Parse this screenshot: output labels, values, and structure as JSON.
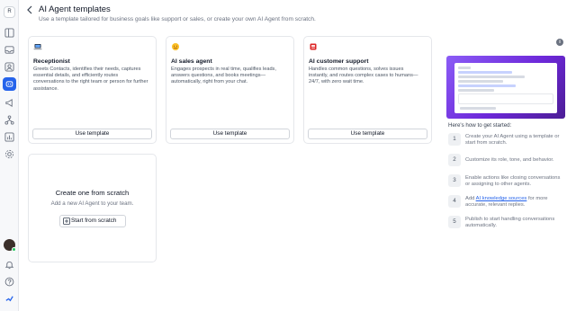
{
  "workspace": {
    "initial": "R"
  },
  "header": {
    "title": "AI Agent templates",
    "subtitle": "Use a template tailored for business goals like support or sales, or create your own AI Agent from scratch."
  },
  "templates": [
    {
      "name": "Receptionist",
      "icon": "laptop-icon",
      "description": "Greets Contacts, identifies their needs, captures essential details, and efficiently routes conversations to the right team or person for further assistance.",
      "button": "Use template"
    },
    {
      "name": "AI sales agent",
      "icon": "smile-emoji-icon",
      "description": "Engages prospects in real time, qualifies leads, answers questions, and books meetings—automatically, right from your chat.",
      "button": "Use template"
    },
    {
      "name": "AI customer support",
      "icon": "support-icon",
      "description": "Handles common questions, solves issues instantly, and routes complex cases to humans—24/7, with zero wait time.",
      "button": "Use template"
    }
  ],
  "scratch": {
    "title": "Create one from scratch",
    "text": "Add a new AI Agent to your team.",
    "button": "Start from scratch"
  },
  "guide": {
    "heading": "Here's how to get started:",
    "steps": [
      {
        "num": "1",
        "text": "Create your AI Agent using a template or start from scratch."
      },
      {
        "num": "2",
        "text": "Customize its role, tone, and behavior."
      },
      {
        "num": "3",
        "text": "Enable actions like closing conversations or assigning to other agents."
      },
      {
        "num": "4",
        "pre": "Add ",
        "link": "AI knowledge sources",
        "post": " for more accurate, relevant replies."
      },
      {
        "num": "5",
        "text": "Publish to start handling conversations automatically."
      }
    ]
  },
  "colors": {
    "accent": "#2563eb",
    "preview_bg": "#7c3aed"
  }
}
